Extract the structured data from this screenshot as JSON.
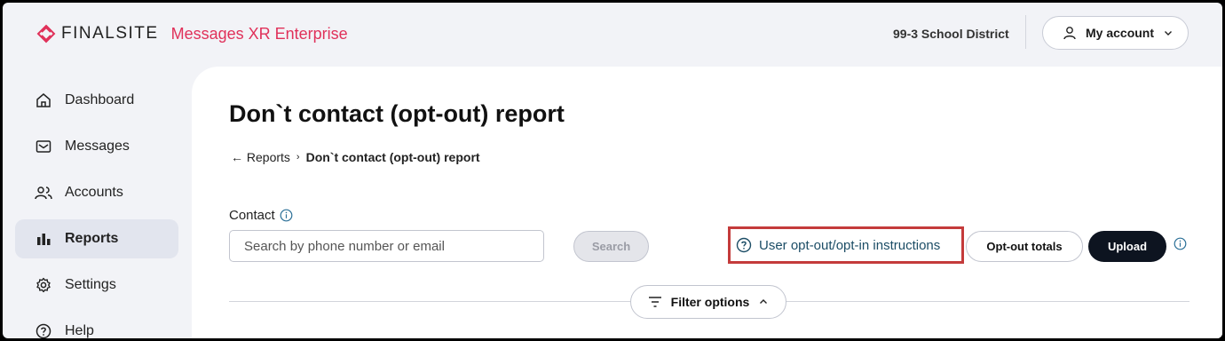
{
  "header": {
    "logo_text": "FINALSITE",
    "product_name": "Messages XR Enterprise",
    "district": "99-3 School District",
    "account_label": "My account",
    "brand_color": "#e0315a"
  },
  "sidebar": {
    "items": [
      {
        "label": "Dashboard",
        "icon": "home-icon",
        "active": false
      },
      {
        "label": "Messages",
        "icon": "envelope-icon",
        "active": false
      },
      {
        "label": "Accounts",
        "icon": "users-icon",
        "active": false
      },
      {
        "label": "Reports",
        "icon": "bar-chart-icon",
        "active": true
      },
      {
        "label": "Settings",
        "icon": "gear-icon",
        "active": false
      },
      {
        "label": "Help",
        "icon": "help-icon",
        "active": false
      }
    ]
  },
  "page": {
    "title": "Don`t contact (opt-out) report",
    "breadcrumb": {
      "back_label": "Reports",
      "current": "Don`t contact (opt-out) report"
    },
    "contact_label": "Contact",
    "search_placeholder": "Search by phone number or email",
    "search_button": "Search",
    "instructions_link": "User opt-out/opt-in instructions",
    "optout_totals_button": "Opt-out totals",
    "upload_button": "Upload",
    "filter_button": "Filter options"
  }
}
